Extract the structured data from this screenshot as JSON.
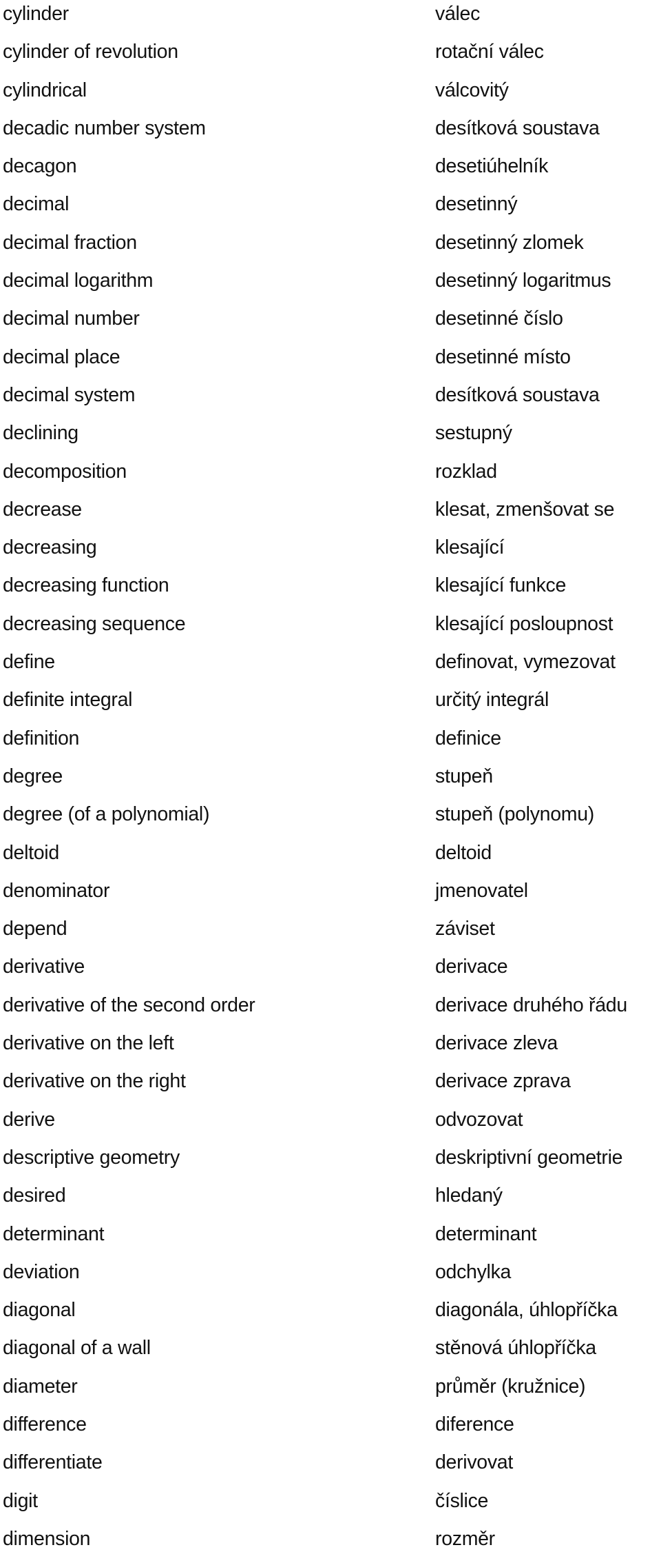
{
  "glossary": {
    "rows": [
      {
        "en": "cylinder",
        "cs": "válec"
      },
      {
        "en": "cylinder of revolution",
        "cs": "rotační válec"
      },
      {
        "en": "cylindrical",
        "cs": "válcovitý"
      },
      {
        "en": "decadic number system",
        "cs": "desítková soustava"
      },
      {
        "en": "decagon",
        "cs": "desetiúhelník"
      },
      {
        "en": "decimal",
        "cs": "desetinný"
      },
      {
        "en": "decimal fraction",
        "cs": "desetinný zlomek"
      },
      {
        "en": "decimal logarithm",
        "cs": "desetinný logaritmus"
      },
      {
        "en": "decimal number",
        "cs": "desetinné číslo"
      },
      {
        "en": "decimal place",
        "cs": "desetinné místo"
      },
      {
        "en": "decimal system",
        "cs": "desítková soustava"
      },
      {
        "en": "declining",
        "cs": "sestupný"
      },
      {
        "en": "decomposition",
        "cs": "rozklad"
      },
      {
        "en": "decrease",
        "cs": "klesat, zmenšovat se"
      },
      {
        "en": "decreasing",
        "cs": "klesající"
      },
      {
        "en": "decreasing function",
        "cs": "klesající funkce"
      },
      {
        "en": "decreasing sequence",
        "cs": "klesající posloupnost"
      },
      {
        "en": "define",
        "cs": "definovat, vymezovat"
      },
      {
        "en": "definite integral",
        "cs": "určitý integrál"
      },
      {
        "en": "definition",
        "cs": "definice"
      },
      {
        "en": "degree",
        "cs": "stupeň"
      },
      {
        "en": "degree (of a polynomial)",
        "cs": "stupeň (polynomu)"
      },
      {
        "en": "deltoid",
        "cs": "deltoid"
      },
      {
        "en": "denominator",
        "cs": "jmenovatel"
      },
      {
        "en": "depend",
        "cs": "záviset"
      },
      {
        "en": "derivative",
        "cs": "derivace"
      },
      {
        "en": "derivative of the second order",
        "cs": "derivace druhého řádu"
      },
      {
        "en": "derivative on the left",
        "cs": "derivace zleva"
      },
      {
        "en": "derivative on the right",
        "cs": "derivace zprava"
      },
      {
        "en": "derive",
        "cs": "odvozovat"
      },
      {
        "en": "descriptive geometry",
        "cs": "deskriptivní geometrie"
      },
      {
        "en": "desired",
        "cs": "hledaný"
      },
      {
        "en": "determinant",
        "cs": "determinant"
      },
      {
        "en": "deviation",
        "cs": "odchylka"
      },
      {
        "en": "diagonal",
        "cs": "diagonála, úhlopříčka"
      },
      {
        "en": "diagonal of a wall",
        "cs": "stěnová úhlopříčka"
      },
      {
        "en": "diameter",
        "cs": "průměr (kružnice)"
      },
      {
        "en": "difference",
        "cs": "diference"
      },
      {
        "en": "differentiate",
        "cs": "derivovat"
      },
      {
        "en": "digit",
        "cs": "číslice"
      },
      {
        "en": "dimension",
        "cs": "rozměr"
      }
    ]
  }
}
